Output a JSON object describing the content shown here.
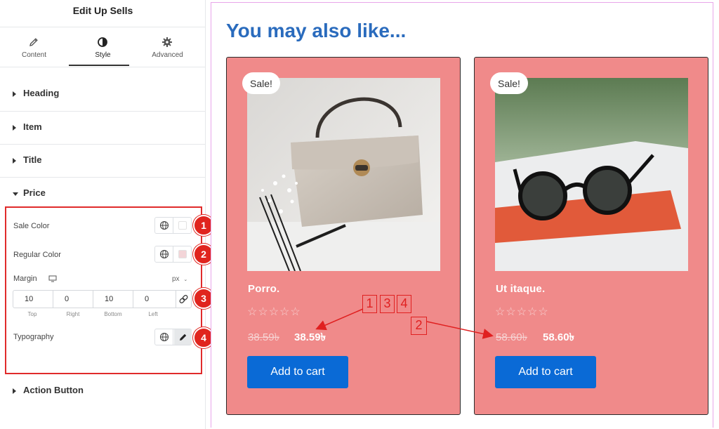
{
  "panel": {
    "title": "Edit Up Sells",
    "tabs": [
      {
        "label": "Content",
        "icon": "pencil-icon"
      },
      {
        "label": "Style",
        "icon": "half-circle-icon"
      },
      {
        "label": "Advanced",
        "icon": "gear-icon"
      }
    ],
    "sections": [
      "Heading",
      "Item",
      "Title",
      "Price",
      "Action Button"
    ],
    "price": {
      "sale_color_label": "Sale Color",
      "regular_color_label": "Regular Color",
      "margin_label": "Margin",
      "margin_unit": "px",
      "margin_values": {
        "top": "10",
        "right": "0",
        "bottom": "10",
        "left": "0"
      },
      "margin_sublabels": {
        "top": "Top",
        "right": "Right",
        "bottom": "Bottom",
        "left": "Left"
      },
      "typography_label": "Typography",
      "sale_color": "#ffffff",
      "regular_color": "#f3d5d8"
    },
    "badges": [
      "1",
      "2",
      "3",
      "4"
    ]
  },
  "preview": {
    "heading": "You may also like...",
    "products": [
      {
        "name": "Porro.",
        "sale_badge": "Sale!",
        "old_price": "38.59৳",
        "price": "38.59৳",
        "rating": "☆☆☆☆☆",
        "button": "Add to cart",
        "image": "handbag-photo"
      },
      {
        "name": "Ut itaque.",
        "sale_badge": "Sale!",
        "old_price": "58.60৳",
        "price": "58.60৳",
        "rating": "☆☆☆☆☆",
        "button": "Add to cart",
        "image": "sunglasses-photo"
      }
    ],
    "annotations": [
      "1",
      "3",
      "4",
      "2"
    ]
  },
  "colors": {
    "card_bg": "#f08a8a",
    "accent_red": "#e0251e",
    "heading_blue": "#2a6bbd",
    "button_blue": "#0a6ad6"
  }
}
